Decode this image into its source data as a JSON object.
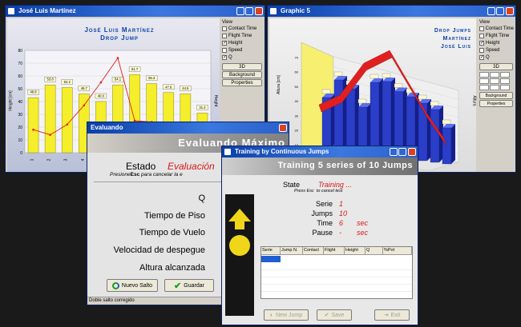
{
  "window1": {
    "title": "José Luis Martínez",
    "chart_title": "José Luis Martínez",
    "chart_subtitle": "Drop Jump",
    "ylabel": "Height [cm]",
    "side_label": "Height",
    "panel": {
      "group": "View",
      "options": [
        {
          "label": "Contact Time",
          "checked": false
        },
        {
          "label": "Flight Time",
          "checked": false
        },
        {
          "label": "Height",
          "checked": true
        },
        {
          "label": "Speed",
          "checked": false
        },
        {
          "label": "Q",
          "checked": true
        }
      ],
      "btn_3d": "3D",
      "btn_background": "Background",
      "btn_properties": "Properties"
    }
  },
  "chart_data": [
    {
      "type": "bar",
      "title": "José Luis Martínez",
      "subtitle": "Drop Jump",
      "ylabel": "Height [cm]",
      "ylim": [
        0,
        80
      ],
      "categories": [
        "1",
        "2",
        "3",
        "4",
        "5",
        "6",
        "7",
        "8",
        "9",
        "10"
      ],
      "series": [
        {
          "name": "Height",
          "values": [
            43,
            53,
            51,
            46,
            40,
            53,
            61,
            54,
            47,
            46,
            31
          ]
        },
        {
          "name": "Q",
          "values": [
            18,
            14,
            22,
            37,
            55,
            74,
            25,
            24,
            10,
            8,
            0
          ]
        }
      ],
      "bar_labels": [
        "46.8",
        "53.8",
        "52.2",
        "46.7",
        "40.0",
        "54.1",
        "61.7",
        "55.3",
        "47.6",
        "44.5",
        "31.4"
      ]
    },
    {
      "type": "bar",
      "title": "Drop Jumps Martínez José Luis",
      "categories": [
        "1",
        "2",
        "3",
        "4",
        "5",
        "6",
        "7",
        "8",
        "9",
        "10",
        "11"
      ],
      "series": [
        {
          "name": "Height",
          "values": [
            42,
            58,
            52,
            38,
            60,
            62,
            55,
            52,
            48,
            44,
            30
          ]
        }
      ]
    }
  ],
  "window2": {
    "title": "Graphic 5",
    "chart_title_line1": "Drop Jumps",
    "chart_title_line2": "Martínez",
    "chart_title_line3": "José Luis",
    "ylabel": "Altura [cm]",
    "side_label": "Altura",
    "panel": {
      "group": "View",
      "options": [
        {
          "label": "Contact Time",
          "checked": false
        },
        {
          "label": "Flight Time",
          "checked": false
        },
        {
          "label": "Height",
          "checked": true
        },
        {
          "label": "Speed",
          "checked": false
        },
        {
          "label": "Q",
          "checked": true
        }
      ],
      "btn_3d": "3D",
      "btn_background": "Background",
      "btn_properties": "Properties"
    }
  },
  "window3": {
    "title": "Evaluando",
    "header": "Evaluando Máximo",
    "estado_label": "Estado",
    "estado_value": "Evaluación",
    "hint_pre": "Presione",
    "hint_key": "Esc",
    "hint_post": "para cancelar la e",
    "fields": [
      "Q",
      "Tiempo de Piso",
      "Tiempo de Vuelo",
      "Velocidad de despegue",
      "Altura alcanzada"
    ],
    "btn_new": "Nuevo Salto",
    "btn_save": "Guardar",
    "status": "Doble salto corregido"
  },
  "window4": {
    "title": "Training by Continuous Jumps",
    "header": "Training 5 series of 10 Jumps",
    "state_label": "State",
    "state_value": "Training ...",
    "hint": "Press Esc  to cancel test",
    "rows": [
      {
        "label": "Serie",
        "value": "1",
        "unit": ""
      },
      {
        "label": "Jumps",
        "value": "10",
        "unit": ""
      },
      {
        "label": "Time",
        "value": "6",
        "unit": "sec"
      },
      {
        "label": "Pause",
        "value": "-",
        "unit": "sec"
      }
    ],
    "table_headers": [
      "Serie",
      "Jump N.",
      "Contact",
      "Flight",
      "Height",
      "Q",
      "%Pot"
    ],
    "btn_1": "New Jump",
    "btn_2": "Save",
    "btn_3": "Exit"
  },
  "colors": {
    "bar_yellow": "#f5ee2a",
    "bar_blue": "#2a3ec8",
    "line_red": "#e02020",
    "title_blue": "#0a3fa8",
    "accent_red": "#d81818"
  }
}
